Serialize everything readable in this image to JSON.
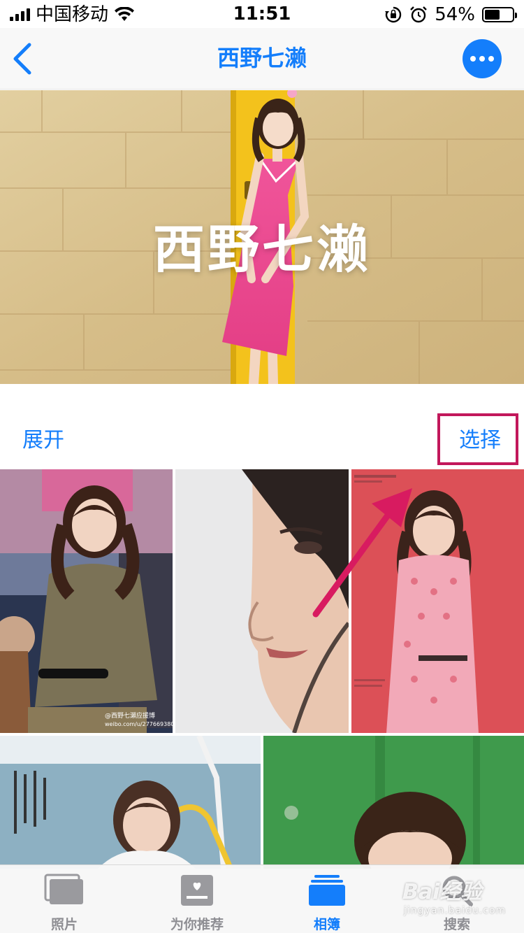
{
  "status_bar": {
    "carrier": "中国移动",
    "time": "11:51",
    "battery_percent": "54%",
    "battery_level": 0.54
  },
  "nav": {
    "title": "西野七濑"
  },
  "hero": {
    "title": "西野七濑"
  },
  "actions": {
    "expand_label": "展开",
    "select_label": "选择"
  },
  "photos": {
    "row1": [
      "photo-1",
      "photo-2",
      "photo-3"
    ],
    "row2": [
      "photo-4",
      "photo-5"
    ],
    "photo_1_caption": "@西野七瀬应援博",
    "photo_1_sub": "weibo.com/u/2776693805"
  },
  "tab_bar": {
    "tabs": [
      {
        "label": "照片",
        "icon": "photos-icon"
      },
      {
        "label": "为你推荐",
        "icon": "for-you-icon"
      },
      {
        "label": "相簿",
        "icon": "albums-icon",
        "active": true
      },
      {
        "label": "搜索",
        "icon": "search-icon"
      }
    ]
  },
  "watermark": {
    "main": "Bai经验",
    "sub": "jingyan.baidu.com"
  },
  "colors": {
    "accent": "#147efb",
    "highlight_border": "#c2185b",
    "arrow": "#d81b60"
  }
}
